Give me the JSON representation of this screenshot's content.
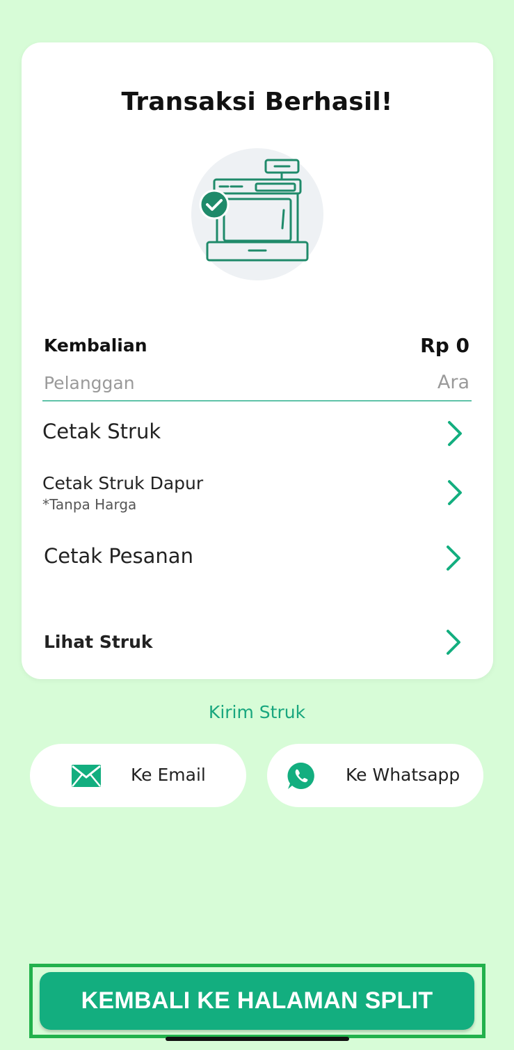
{
  "title": "Transaksi Berhasil!",
  "summary": {
    "change_label": "Kembalian",
    "change_value": "Rp 0",
    "customer_label": "Pelanggan",
    "customer_value": "Ara"
  },
  "menu": [
    {
      "title": "Cetak Struk",
      "subtitle": ""
    },
    {
      "title": "Cetak Struk Dapur",
      "subtitle": "*Tanpa Harga"
    },
    {
      "title": "Cetak Pesanan",
      "subtitle": ""
    },
    {
      "title": "Lihat Struk",
      "subtitle": ""
    }
  ],
  "send": {
    "heading": "Kirim Struk",
    "email_label": "Ke Email",
    "whatsapp_label": "Ke Whatsapp"
  },
  "back_button": "KEMBALI KE HALAMAN SPLIT",
  "colors": {
    "background": "#d7fcd7",
    "accent": "#13ae7f",
    "highlight_outline": "#22b14c"
  },
  "icons": {
    "illustration": "cash-register-success-icon",
    "chevron": "chevron-right-icon",
    "email": "envelope-icon",
    "whatsapp": "whatsapp-icon"
  }
}
